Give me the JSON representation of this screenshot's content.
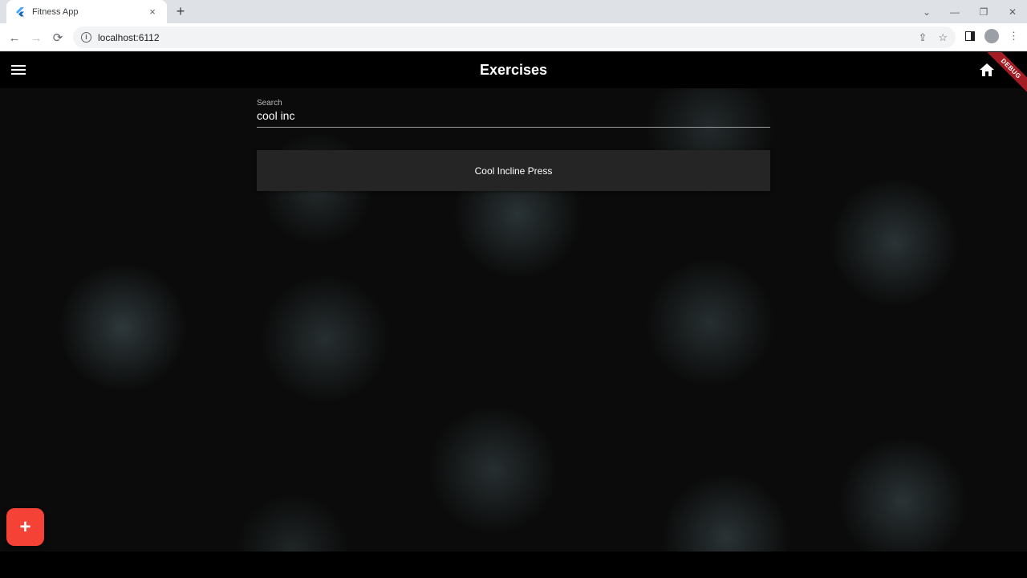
{
  "browser": {
    "tab_title": "Fitness App",
    "tab_close": "×",
    "new_tab": "+",
    "url": "localhost:6112",
    "back": "←",
    "forward": "→",
    "reload": "⟳",
    "share": "⇪",
    "star": "☆",
    "window_controls": [
      "⌄",
      "—",
      "❐",
      "✕"
    ]
  },
  "app": {
    "title": "Exercises",
    "debug_badge": "DEBUG",
    "search": {
      "label": "Search",
      "value": "cool inc"
    },
    "results": [
      {
        "label": "Cool Incline Press"
      }
    ],
    "fab_label": "+",
    "colors": {
      "accent": "#f44336",
      "appbar": "#000000",
      "card": "#252525",
      "ribbon": "#a51d24"
    }
  }
}
